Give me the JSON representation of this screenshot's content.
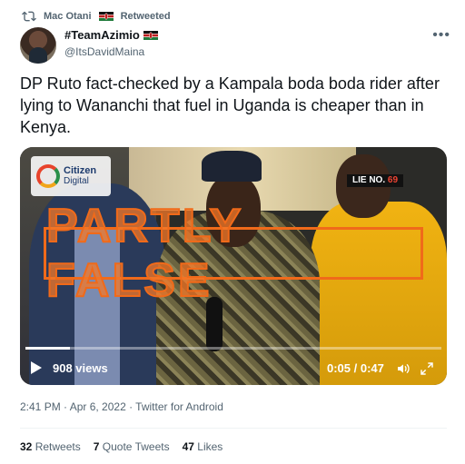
{
  "retweet": {
    "icon": "retweet-icon",
    "user": "Mac Otani",
    "label": "Retweeted"
  },
  "author": {
    "display_name": "#TeamAzimio",
    "handle": "@ItsDavidMaina",
    "flag_icon": "kenya-flag-icon"
  },
  "tweet": {
    "text": "DP Ruto fact-checked by a Kampala boda boda rider after lying to Wananchi that fuel in Uganda is cheaper than in Kenya."
  },
  "media": {
    "logo_line1": "Citizen",
    "logo_line2": "Digital",
    "badge_main": "LIE NO. ",
    "badge_number": "69",
    "stamp": "PARTLY FALSE",
    "views": "908 views",
    "time": "0:05 / 0:47",
    "progress": 0.106,
    "stamp_color": "#f06a1a"
  },
  "meta": {
    "timestamp": "2:41 PM · Apr 6, 2022 · Twitter for Android"
  },
  "stats": {
    "retweets_count": "32",
    "retweets_label": "Retweets",
    "quotes_count": "7",
    "quotes_label": "Quote Tweets",
    "likes_count": "47",
    "likes_label": "Likes"
  },
  "colors": {
    "secondary_text": "#536471",
    "primary_text": "#0f1419"
  }
}
